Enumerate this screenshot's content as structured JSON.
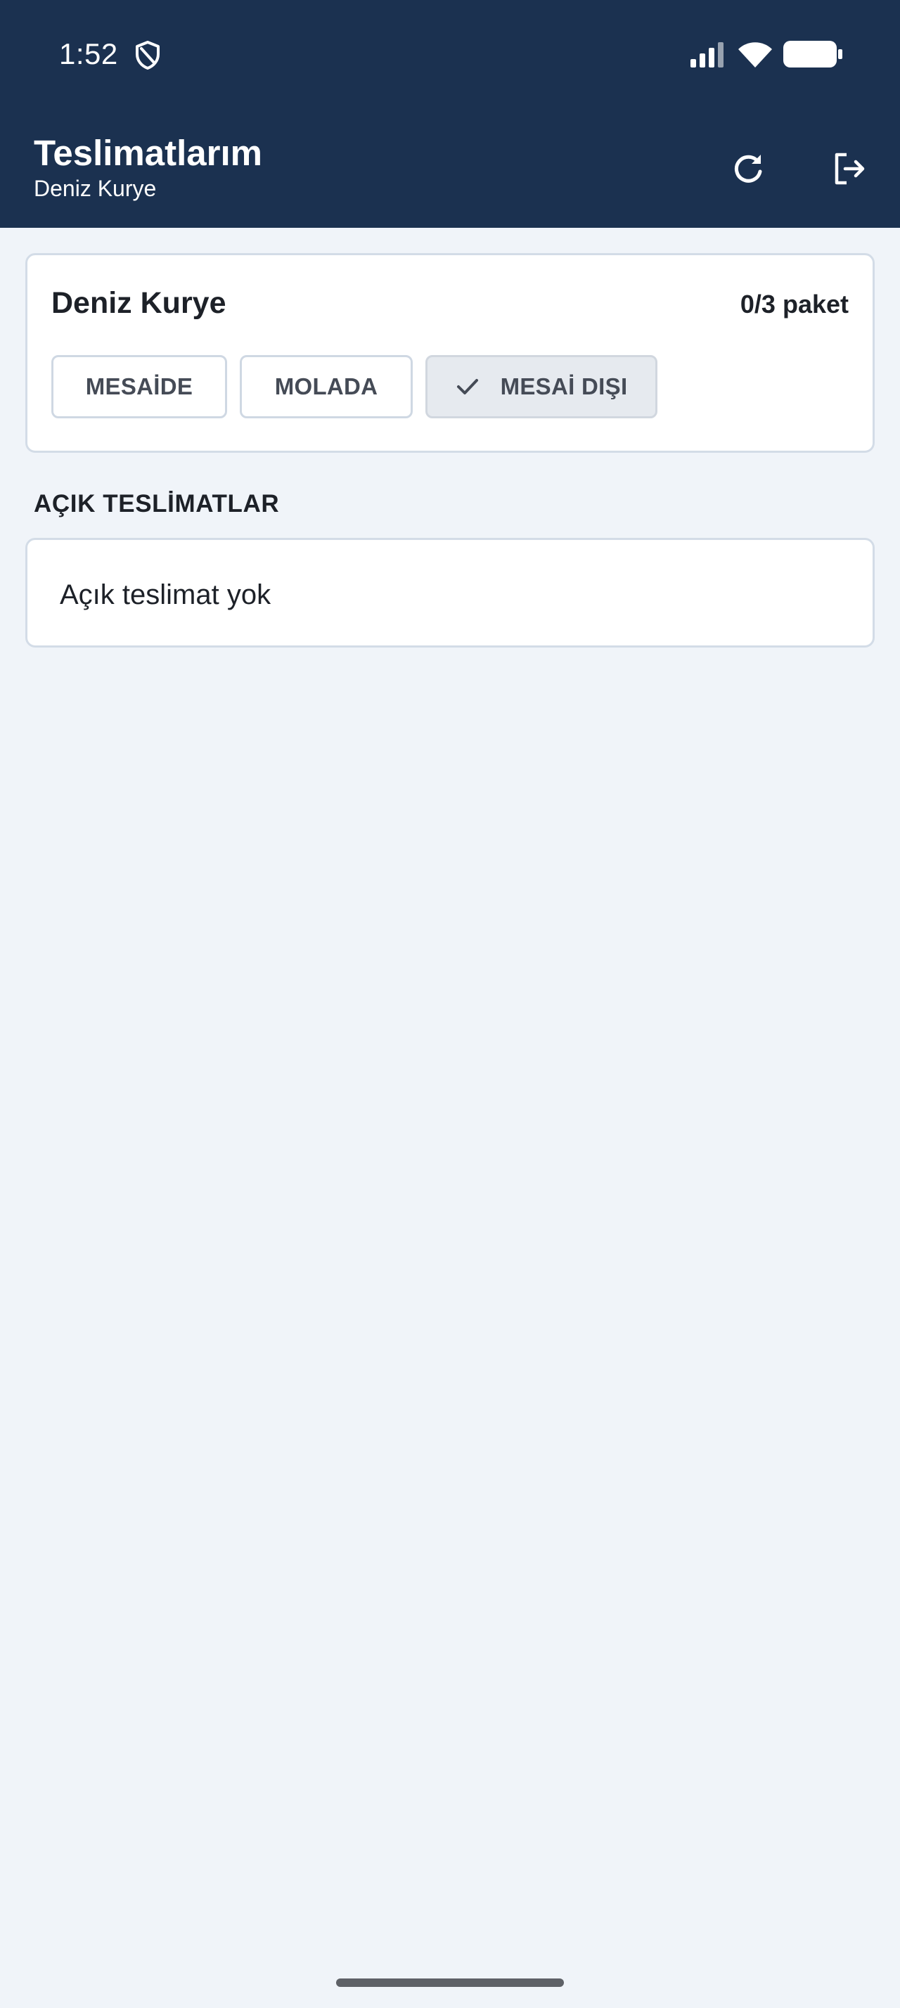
{
  "status_bar": {
    "time": "1:52",
    "icons": [
      "shield-icon",
      "signal-icon",
      "wifi-icon",
      "battery-icon"
    ]
  },
  "app_bar": {
    "title": "Teslimatlarım",
    "subtitle": "Deniz Kurye",
    "actions": [
      "refresh-icon",
      "logout-icon"
    ],
    "background": "#1b3150"
  },
  "courier_card": {
    "name": "Deniz Kurye",
    "package_count": "0/3 paket",
    "status_options": [
      {
        "label": "MESAİDE",
        "selected": false
      },
      {
        "label": "MOLADA",
        "selected": false
      },
      {
        "label": "MESAİ DIŞI",
        "selected": true
      }
    ]
  },
  "open_deliveries": {
    "section_title": "AÇIK TESLİMATLAR",
    "empty_message": "Açık teslimat yok"
  },
  "colors": {
    "page_background": "#f0f4f9",
    "card_border": "#d3dce7",
    "selected_segment": "#e6eaef"
  }
}
